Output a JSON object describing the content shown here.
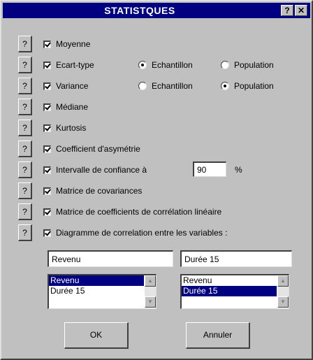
{
  "title": "STATISTQUES",
  "title_buttons": {
    "help": "?",
    "close": "✕"
  },
  "help_label": "?",
  "options": [
    {
      "label": "Moyenne",
      "checked": true
    },
    {
      "label": "Ecart-type",
      "checked": true
    },
    {
      "label": "Variance",
      "checked": true
    },
    {
      "label": "Médiane",
      "checked": true
    },
    {
      "label": "Kurtosis",
      "checked": true
    },
    {
      "label": "Coefficient d'asymétrie",
      "checked": true
    },
    {
      "label": "Intervalle de confiance à",
      "checked": true
    },
    {
      "label": "Matrice de covariances",
      "checked": true
    },
    {
      "label": "Matrice de coefficients de corrélation linéaire",
      "checked": true
    },
    {
      "label": "Diagramme de correlation entre les variables :",
      "checked": true
    }
  ],
  "ecart_type_radios": [
    {
      "label": "Echantillon",
      "selected": true
    },
    {
      "label": "Population",
      "selected": false
    }
  ],
  "variance_radios": [
    {
      "label": "Echantillon",
      "selected": false
    },
    {
      "label": "Population",
      "selected": true
    }
  ],
  "confidence": {
    "value": "90",
    "unit": "%"
  },
  "variable_fields": {
    "left": "Revenu",
    "right": "Durée 15"
  },
  "list_left": {
    "items": [
      "Revenu",
      "Durée 15"
    ],
    "selected_index": 0
  },
  "list_right": {
    "items": [
      "Revenu",
      "Durée 15"
    ],
    "selected_index": 1
  },
  "buttons": {
    "ok": "OK",
    "cancel": "Annuler"
  },
  "colors": {
    "title_bar": "#000080",
    "face": "#c0c0c0",
    "selection": "#000080"
  }
}
